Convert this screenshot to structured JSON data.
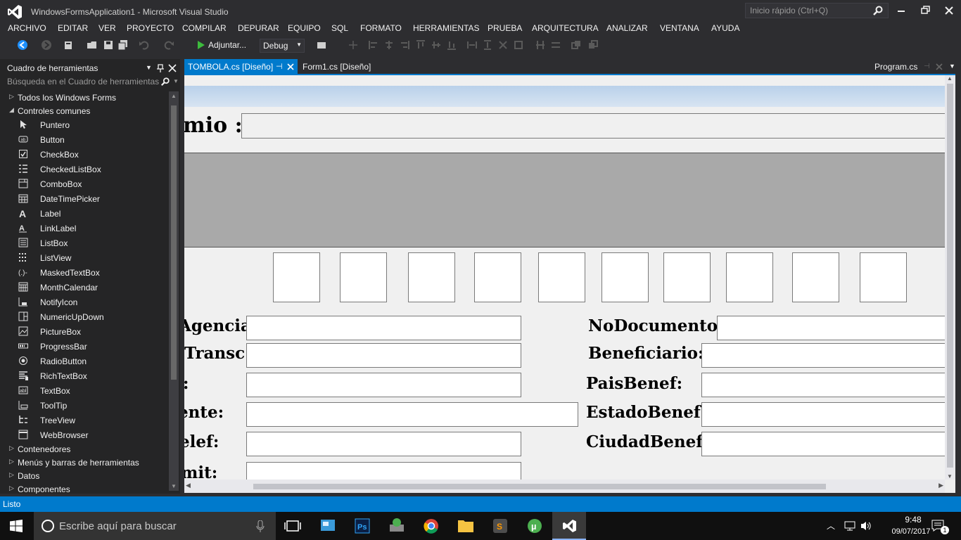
{
  "window": {
    "title": "WindowsFormsApplication1 - Microsoft Visual Studio",
    "quick_launch_placeholder": "Inicio rápido (Ctrl+Q)"
  },
  "menu": [
    "ARCHIVO",
    "EDITAR",
    "VER",
    "PROYECTO",
    "COMPILAR",
    "DEPURAR",
    "EQUIPO",
    "SQL",
    "FORMATO",
    "HERRAMIENTAS",
    "PRUEBA",
    "ARQUITECTURA",
    "ANALIZAR",
    "VENTANA",
    "AYUDA"
  ],
  "toolbar": {
    "attach_label": "Adjuntar...",
    "config_value": "Debug"
  },
  "toolbox": {
    "title": "Cuadro de herramientas",
    "search_placeholder": "Búsqueda en el Cuadro de herramientas",
    "group_all": "Todos los Windows Forms",
    "group_common": "Controles comunes",
    "common_items": [
      "Puntero",
      "Button",
      "CheckBox",
      "CheckedListBox",
      "ComboBox",
      "DateTimePicker",
      "Label",
      "LinkLabel",
      "ListBox",
      "ListView",
      "MaskedTextBox",
      "MonthCalendar",
      "NotifyIcon",
      "NumericUpDown",
      "PictureBox",
      "ProgressBar",
      "RadioButton",
      "RichTextBox",
      "TextBox",
      "ToolTip",
      "TreeView",
      "WebBrowser"
    ],
    "groups_after": [
      "Contenedores",
      "Menús y barras de herramientas",
      "Datos",
      "Componentes"
    ]
  },
  "tabs": {
    "active": "TOMBOLA.cs [Diseño]",
    "second": "Form1.cs [Diseño]",
    "preview": "Program.cs"
  },
  "form": {
    "top_label": "mio :",
    "left_labels": [
      "Agencia:",
      "Transc:",
      ":",
      "ente:",
      "elef:",
      "mit:"
    ],
    "right_labels": [
      "NoDocumento:",
      "Beneficiario:",
      "PaisBenef:",
      "EstadoBenef:",
      "CiudadBenef:"
    ]
  },
  "status": {
    "text": "Listo"
  },
  "taskbar": {
    "search_placeholder": "Escribe aquí para buscar",
    "time": "9:48",
    "date": "09/07/2017",
    "notification_count": "1"
  },
  "colors": {
    "accent": "#007acc",
    "background": "#2d2d30",
    "toolbox_bg": "#252526",
    "form_bg": "#f0f0f0",
    "panel_gray": "#a9a9a9"
  }
}
